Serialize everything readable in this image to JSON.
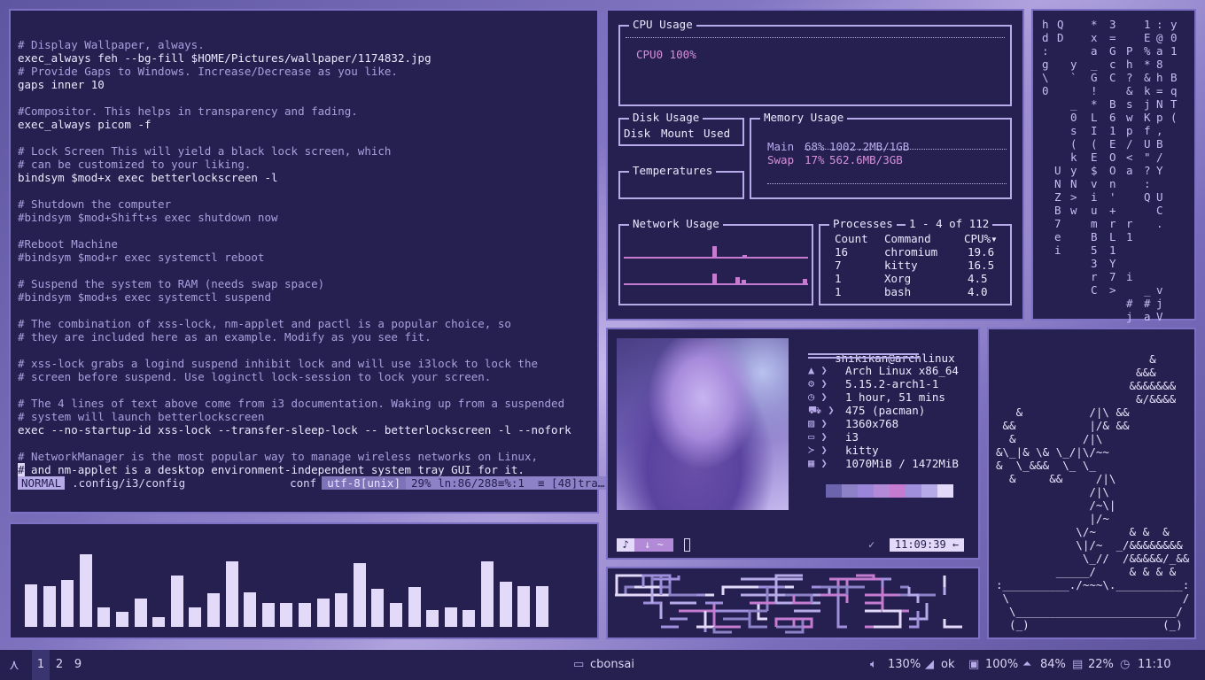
{
  "editor": {
    "lines": [
      {
        "t": "# Display Wallpaper, always.",
        "c": "cmt"
      },
      {
        "t": "exec_always feh --bg-fill $HOME/Pictures/wallpaper/1174832.jpg",
        "c": "code"
      },
      {
        "t": "# Provide Gaps to Windows. Increase/Decrease as you like.",
        "c": "cmt"
      },
      {
        "t": "gaps inner 10",
        "c": "code"
      },
      {
        "t": "",
        "c": "code"
      },
      {
        "t": "#Compositor. This helps in transparency and fading.",
        "c": "cmt"
      },
      {
        "t": "exec_always picom -f",
        "c": "code"
      },
      {
        "t": "",
        "c": "code"
      },
      {
        "t": "# Lock Screen This will yield a black lock screen, which",
        "c": "cmt"
      },
      {
        "t": "# can be customized to your liking.",
        "c": "cmt"
      },
      {
        "t": "bindsym $mod+x exec betterlockscreen -l",
        "c": "code"
      },
      {
        "t": "",
        "c": "code"
      },
      {
        "t": "# Shutdown the computer",
        "c": "cmt"
      },
      {
        "t": "#bindsym $mod+Shift+s exec shutdown now",
        "c": "cmt"
      },
      {
        "t": "",
        "c": "code"
      },
      {
        "t": "#Reboot Machine",
        "c": "cmt"
      },
      {
        "t": "#bindsym $mod+r exec systemctl reboot",
        "c": "cmt"
      },
      {
        "t": "",
        "c": "code"
      },
      {
        "t": "# Suspend the system to RAM (needs swap space)",
        "c": "cmt"
      },
      {
        "t": "#bindsym $mod+s exec systemctl suspend",
        "c": "cmt"
      },
      {
        "t": "",
        "c": "code"
      },
      {
        "t": "# The combination of xss-lock, nm-applet and pactl is a popular choice, so",
        "c": "cmt"
      },
      {
        "t": "# they are included here as an example. Modify as you see fit.",
        "c": "cmt"
      },
      {
        "t": "",
        "c": "code"
      },
      {
        "t": "# xss-lock grabs a logind suspend inhibit lock and will use i3lock to lock the",
        "c": "cmt"
      },
      {
        "t": "# screen before suspend. Use loginctl lock-session to lock your screen.",
        "c": "cmt"
      },
      {
        "t": "",
        "c": "code"
      },
      {
        "t": "# The 4 lines of text above come from i3 documentation. Waking up from a suspended",
        "c": "cmt"
      },
      {
        "t": "# system will launch betterlockscreen",
        "c": "cmt"
      },
      {
        "t": "exec --no-startup-id xss-lock --transfer-sleep-lock -- betterlockscreen -l --nofork",
        "c": "code"
      },
      {
        "t": "",
        "c": "code"
      },
      {
        "t": "# NetworkManager is the most popular way to manage wireless networks on Linux,",
        "c": "cmt"
      }
    ],
    "cursor_char": "#",
    "last_line": " and nm-applet is a desktop environment-independent system tray GUI for it.",
    "status": {
      "mode": "NORMAL",
      "file": ".config/i3/config",
      "filetype": "conf",
      "encoding": "utf-8[unix]",
      "position": "29% ln:86/288≡%:1  ≡ [48]tra…"
    }
  },
  "btop": {
    "cpu": {
      "title": "CPU Usage",
      "core_label": "CPU0 100%"
    },
    "disk": {
      "title": "Disk Usage",
      "headers": [
        "Disk",
        "Mount",
        "Used"
      ]
    },
    "memory": {
      "title": "Memory Usage",
      "main": {
        "label": "Main",
        "percent": "68%",
        "value": "1002.2MB/1GB"
      },
      "swap": {
        "label": "Swap",
        "percent": "17%",
        "value": "562.6MB/3GB"
      }
    },
    "temps": {
      "title": "Temperatures"
    },
    "network": {
      "title": "Network Usage"
    },
    "processes": {
      "title": "Processes",
      "range": "1 - 4 of 112",
      "headers": {
        "count": "Count",
        "command": "Command",
        "cpu": "CPU%▾"
      },
      "rows": [
        {
          "count": "16",
          "command": "chromium",
          "cpu": "19.6"
        },
        {
          "count": "7",
          "command": "kitty",
          "cpu": "16.5"
        },
        {
          "count": "1",
          "command": "Xorg",
          "cpu": "4.5"
        },
        {
          "count": "1",
          "command": "bash",
          "cpu": "4.0"
        }
      ]
    }
  },
  "matrix": {
    "columns": [
      "h\nd\n:\ng\n\\\n0",
      "Q\nD",
      "\n\n\n\n\n\n\n\n\n\n\nU\nN\nZ\nB\n7\ne\ni",
      "\n\n\ny\n`\n\n_\n0\ns\n(\nk\ny\nN\n>\nw",
      "*\nx\na\n_\nG\n!\n*\nL\nI\n(\nE\n$\nv\ni\nu\nm\nB\n5\n3\nr\nC",
      "3\n=\nG\nc\nC\n\nB\n6\n1\nE\nO\nO\nn\n'\n+\nr\nL\n1\nY\n7\n>",
      "\n\nP\nh\n?\n&\ns\nw\np\n/\n<\na\n\n\n\nr\n1\n\n\ni\n\n#\nj",
      "1\nE\n%\n*\n&\nk\nj\nK\nf\nU\n\"\n?\n:\nQ\n\n\n\n\n\n\n_\n#\na",
      ":\n@\na\n8\nh\n=\nN\np\n,\nB\n/\nY\n\nU\nC\n.\n\n\n\n\nv\nj\nV",
      "y\n0\n1\n\nB\nq\nT\n("
    ]
  },
  "neofetch": {
    "user": "shikikan",
    "at": "@",
    "host": "archlinux",
    "info": [
      {
        "icon": "arch-icon",
        "value": "Arch Linux x86_64"
      },
      {
        "icon": "gear-icon",
        "value": "5.15.2-arch1-1"
      },
      {
        "icon": "clock-icon",
        "value": "1 hour, 51 mins"
      },
      {
        "icon": "cart-icon",
        "value": "475 (pacman)"
      },
      {
        "icon": "image-icon",
        "value": "1360x768"
      },
      {
        "icon": "desktop-icon",
        "value": "i3"
      },
      {
        "icon": "terminal-icon",
        "value": "kitty"
      },
      {
        "icon": "memory-icon",
        "value": "1070MiB / 1472MiB"
      }
    ],
    "swatches": [
      "#6c64ad",
      "#8d82c7",
      "#9b85d9",
      "#b38ad8",
      "#c47bd0",
      "#a08fdd",
      "#b7aae8",
      "#e3d9f8"
    ],
    "prompt": {
      "seg1": "♪",
      "seg2": "↓ ~",
      "check": "✓",
      "time": "11:09:39 ←"
    }
  },
  "cava": {
    "levels": [
      0.48,
      0.46,
      0.53,
      0.82,
      0.22,
      0.17,
      0.32,
      0.11,
      0.58,
      0.22,
      0.38,
      0.74,
      0.39,
      0.27,
      0.27,
      0.27,
      0.32,
      0.38,
      0.72,
      0.43,
      0.27,
      0.45,
      0.19,
      0.22,
      0.19,
      0.74,
      0.51,
      0.46,
      0.46
    ]
  },
  "bonsai": {
    "art": "                       &\n                     &&&\n                    &&&&&&&\n                     &/&&&&\n   &          /|\\ &&\n &&           |/& &&\n  &          /|\\\n&\\_|& \\& \\_/|\\/~~\n&  \\_&&&  \\_ \\_\n  &     &&     /|\\\n              /|\\\n              /~\\|\n              |/~\n            \\/~     & &  &\n            \\|/~  _/&&&&&&&&\n             \\_//  /&&&&&/_&&\n         _____/     & & & &\n:__________./~~~\\.__________:\n \\                          /\n  \\________________________/\n  (_)                    (_)"
  },
  "taskbar": {
    "logo": "⋏",
    "workspaces": [
      "1",
      "2",
      "9"
    ],
    "active_workspace": "1",
    "window_title": "cbonsai",
    "volume": "130%",
    "network": "ok",
    "brightness": "100%",
    "cpu": "84%",
    "disk": "22%",
    "time": "11:10"
  }
}
